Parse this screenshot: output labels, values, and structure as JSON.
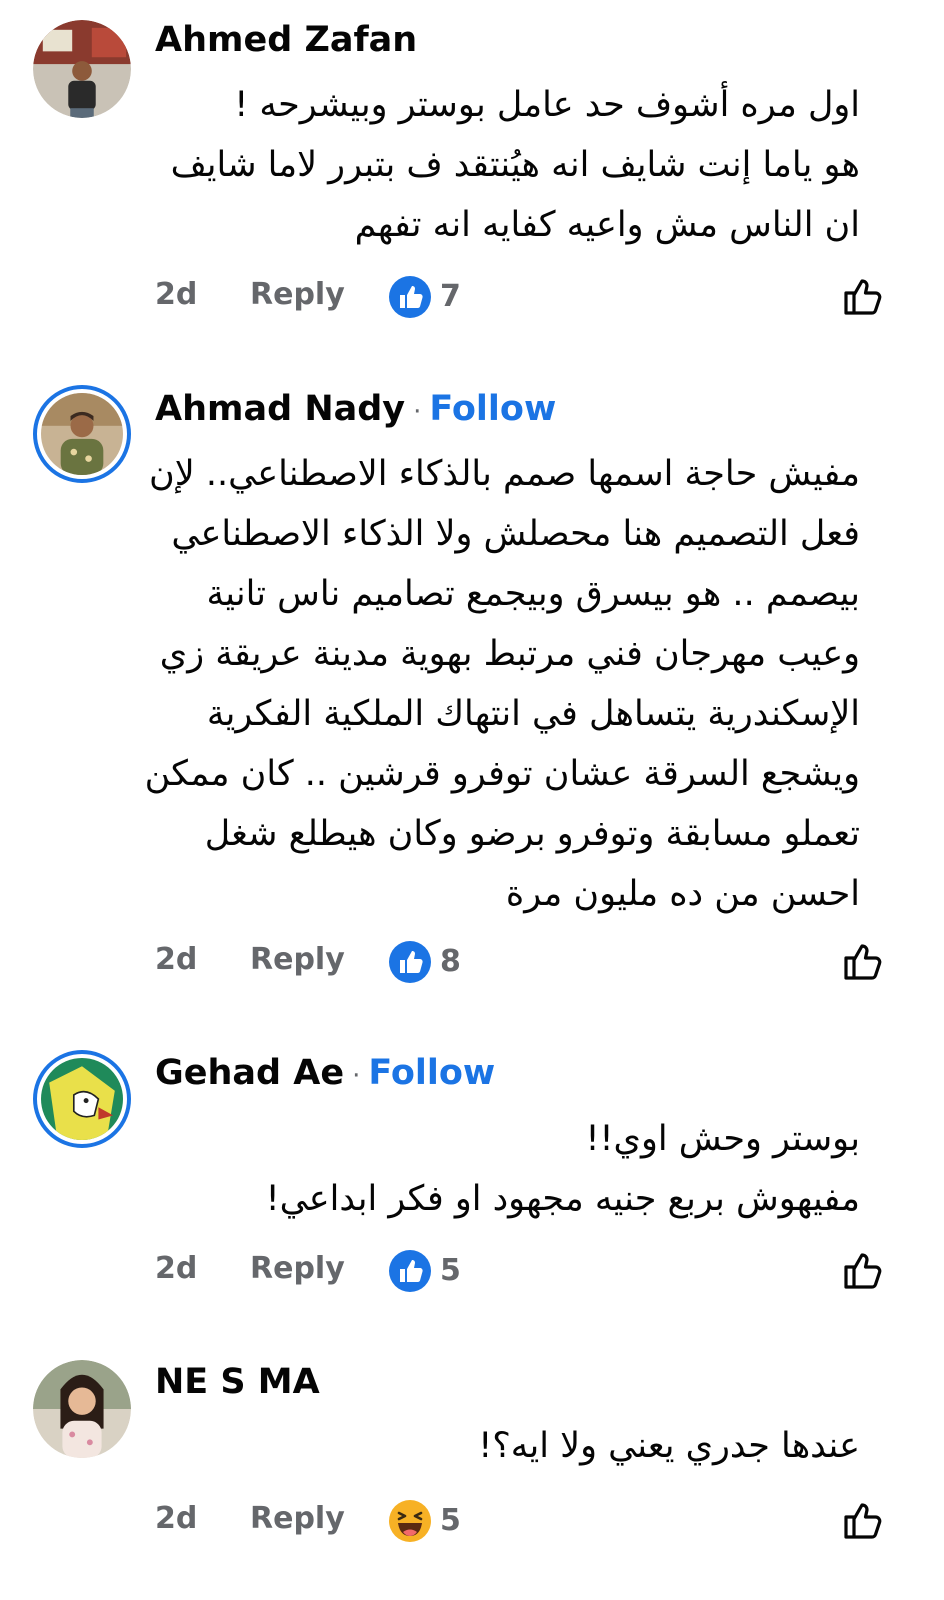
{
  "comments": [
    {
      "author": "Ahmed Zafan",
      "follow": "",
      "lines": [
        "اول مره أشوف حد عامل بوستر وبيشرحه !",
        "هو ياما إنت شايف انه هيُنتقد ف بتبرر لاما شايف",
        "ان الناس مش واعيه كفايه انه تفهم"
      ],
      "time": "2d",
      "reply": "Reply",
      "reaction_icon": "like-reaction-icon",
      "reaction_count": "7"
    },
    {
      "author": "Ahmad Nady",
      "follow": "Follow",
      "lines": [
        "مفيش حاجة اسمها صمم بالذكاء الاصطناعي.. لإن",
        "فعل التصميم هنا محصلش ولا الذكاء الاصطناعي",
        "بيصمم .. هو بيسرق وبيجمع تصاميم ناس تانية",
        "وعيب مهرجان فني مرتبط بهوية مدينة عريقة زي",
        "الإسكندرية يتساهل في انتهاك الملكية الفكرية",
        "ويشجع السرقة عشان توفرو قرشين .. كان ممكن",
        "تعملو مسابقة وتوفرو برضو وكان هيطلع شغل",
        "احسن من ده مليون مرة"
      ],
      "time": "2d",
      "reply": "Reply",
      "reaction_icon": "like-reaction-icon",
      "reaction_count": "8"
    },
    {
      "author": "Gehad Ae",
      "follow": "Follow",
      "lines": [
        "بوستر وحش اوي!!",
        "مفيهوش بربع جنيه مجهود او فكر ابداعي!"
      ],
      "time": "2d",
      "reply": "Reply",
      "reaction_icon": "like-reaction-icon",
      "reaction_count": "5"
    },
    {
      "author": "NE S MA",
      "follow": "",
      "lines": [
        "عندها جدري يعني ولا ايه؟!"
      ],
      "time": "2d",
      "reply": "Reply",
      "reaction_icon": "haha-reaction-icon",
      "reaction_count": "5"
    }
  ],
  "colors": {
    "link": "#1b74e4",
    "meta": "#65676b",
    "text": "#050505",
    "haha": "#f7b125"
  }
}
